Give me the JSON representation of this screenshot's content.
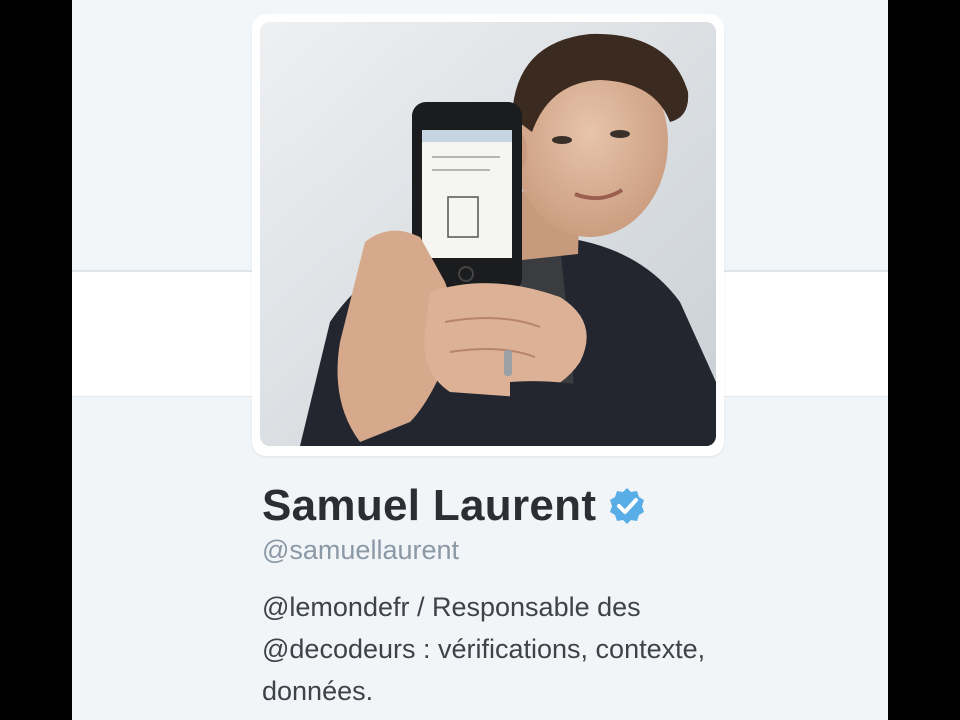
{
  "profile": {
    "display_name": "Samuel Laurent",
    "handle": "@samuellaurent",
    "verified": true,
    "avatar_alt": "profile-photo",
    "bio_line1_mention": "@lemondefr",
    "bio_line1_rest": " / Responsable des",
    "bio_line2_mention": "@decodeurs",
    "bio_line2_rest": " : vérifications, contexte,",
    "bio_line3": "données."
  },
  "colors": {
    "verified_badge": "#5aaee8",
    "name_text": "#2b2f33",
    "handle_text": "#8b98a5",
    "bio_text": "#3d4349"
  },
  "icons": {
    "verified": "verified-badge-icon"
  }
}
